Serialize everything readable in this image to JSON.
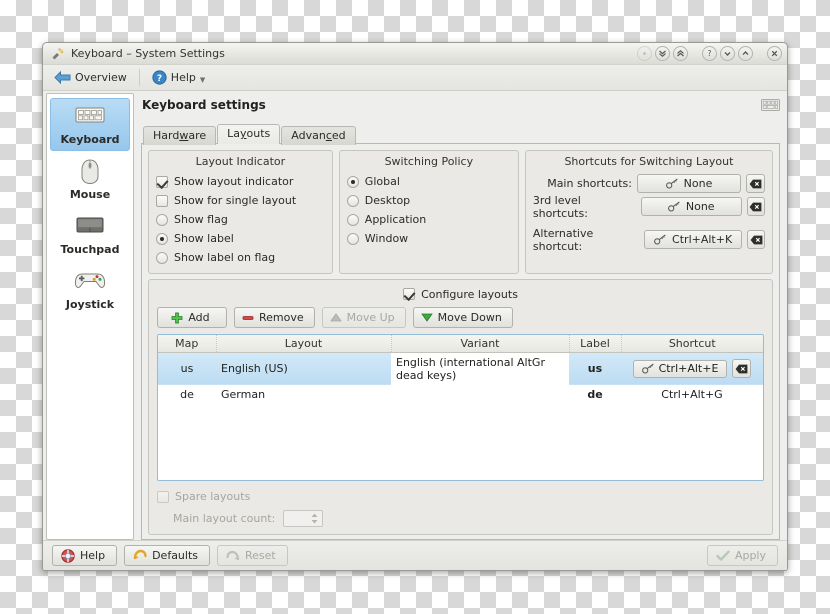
{
  "window": {
    "title": "Keyboard – System Settings",
    "title_icon": "keyboard-tools-icon",
    "controls": [
      {
        "name": "window-menu-button",
        "glyph": "·"
      },
      {
        "name": "shade-down-button",
        "glyph": "»"
      },
      {
        "name": "shade-up-button",
        "glyph": "«"
      },
      {
        "name": "help-button",
        "glyph": "?"
      },
      {
        "name": "minimize-button",
        "glyph": "⌄"
      },
      {
        "name": "maximize-button",
        "glyph": "⌃"
      },
      {
        "name": "close-button",
        "glyph": "✕"
      }
    ]
  },
  "toolbar": {
    "overview_label": "Overview",
    "help_label": "Help"
  },
  "sidebar": {
    "items": [
      {
        "label": "Keyboard",
        "icon": "keyboard-icon",
        "selected": true
      },
      {
        "label": "Mouse",
        "icon": "mouse-icon",
        "selected": false
      },
      {
        "label": "Touchpad",
        "icon": "touchpad-icon",
        "selected": false
      },
      {
        "label": "Joystick",
        "icon": "joystick-icon",
        "selected": false
      }
    ]
  },
  "main": {
    "title": "Keyboard settings",
    "header_icon": "keyboard-icon",
    "tabs": [
      {
        "label": "Hardware",
        "accel": "w",
        "active": false
      },
      {
        "label": "Layouts",
        "accel": "y",
        "active": true
      },
      {
        "label": "Advanced",
        "accel": "c",
        "active": false
      }
    ]
  },
  "layout_indicator": {
    "title": "Layout Indicator",
    "options": [
      {
        "label": "Show layout indicator",
        "type": "checkbox",
        "checked": true
      },
      {
        "label": "Show for single layout",
        "type": "checkbox",
        "checked": false
      },
      {
        "label": "Show flag",
        "type": "radio",
        "checked": false
      },
      {
        "label": "Show label",
        "type": "radio",
        "checked": true
      },
      {
        "label": "Show label on flag",
        "type": "radio",
        "checked": false
      }
    ]
  },
  "switching_policy": {
    "title": "Switching Policy",
    "options": [
      {
        "label": "Global",
        "checked": true
      },
      {
        "label": "Desktop",
        "checked": false
      },
      {
        "label": "Application",
        "checked": false
      },
      {
        "label": "Window",
        "checked": false
      }
    ]
  },
  "shortcuts": {
    "title": "Shortcuts for Switching Layout",
    "rows": [
      {
        "label": "Main shortcuts:",
        "value": "None"
      },
      {
        "label": "3rd level shortcuts:",
        "value": "None"
      },
      {
        "label": "Alternative shortcut:",
        "value": "Ctrl+Alt+K"
      }
    ],
    "clear_icon": "clear-backspace-icon",
    "key_icon": "key-icon"
  },
  "configure": {
    "checkbox_label": "Configure layouts",
    "checked": true,
    "buttons": [
      {
        "label": "Add",
        "icon": "plus-icon",
        "enabled": true
      },
      {
        "label": "Remove",
        "icon": "minus-icon",
        "enabled": true
      },
      {
        "label": "Move Up",
        "icon": "triangle-up-icon",
        "enabled": false
      },
      {
        "label": "Move Down",
        "icon": "triangle-down-icon",
        "enabled": true
      }
    ]
  },
  "layout_table": {
    "columns": [
      "Map",
      "Layout",
      "Variant",
      "Label",
      "Shortcut"
    ],
    "rows": [
      {
        "map": "us",
        "layout": "English (US)",
        "variant": "English (international AltGr dead keys)",
        "label": "us",
        "shortcut": "Ctrl+Alt+E",
        "selected": true
      },
      {
        "map": "de",
        "layout": "German",
        "variant": "",
        "label": "de",
        "shortcut": "Ctrl+Alt+G",
        "selected": false
      }
    ]
  },
  "spare": {
    "checkbox_label": "Spare layouts",
    "checked": false,
    "enabled": false,
    "count_label": "Main layout count:",
    "count_value": ""
  },
  "footer": {
    "help_label": "Help",
    "defaults_label": "Defaults",
    "reset_label": "Reset",
    "apply_label": "Apply"
  },
  "colors": {
    "selection_blue": "#a9d2f1",
    "row_selection": "#bcdcf2",
    "window_bg": "#eeeeec",
    "group_bg": "#eae9e5",
    "accent_green": "#3fa93f",
    "accent_red": "#cc3b3b"
  }
}
